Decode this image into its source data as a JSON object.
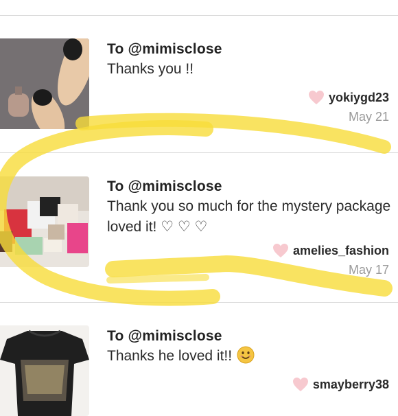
{
  "feed": {
    "items": [
      {
        "to": "To @mimisclose",
        "message_lines": [
          "Thanks you !!"
        ],
        "username": "yokiygd23",
        "date": "May 21",
        "thumbnail_icon": "photo-shoes-perfume"
      },
      {
        "to": "To @mimisclose",
        "message_lines": [
          "Thank you so much for the mystery package",
          "loved it! ♡ ♡ ♡"
        ],
        "username": "amelies_fashion",
        "date": "May 17",
        "thumbnail_icon": "photo-shopping-bags"
      },
      {
        "to": "To @mimisclose",
        "message_lines": [
          "Thanks he loved it!!"
        ],
        "emoji": "smiling-face-emoji",
        "username": "smayberry38",
        "date": "",
        "thumbnail_icon": "photo-graphic-tshirt"
      }
    ]
  },
  "colors": {
    "heart": "#f7c9cf",
    "highlighter": "#f7dc3a",
    "divider": "#d9d9d9",
    "date": "#9a9a9a"
  }
}
